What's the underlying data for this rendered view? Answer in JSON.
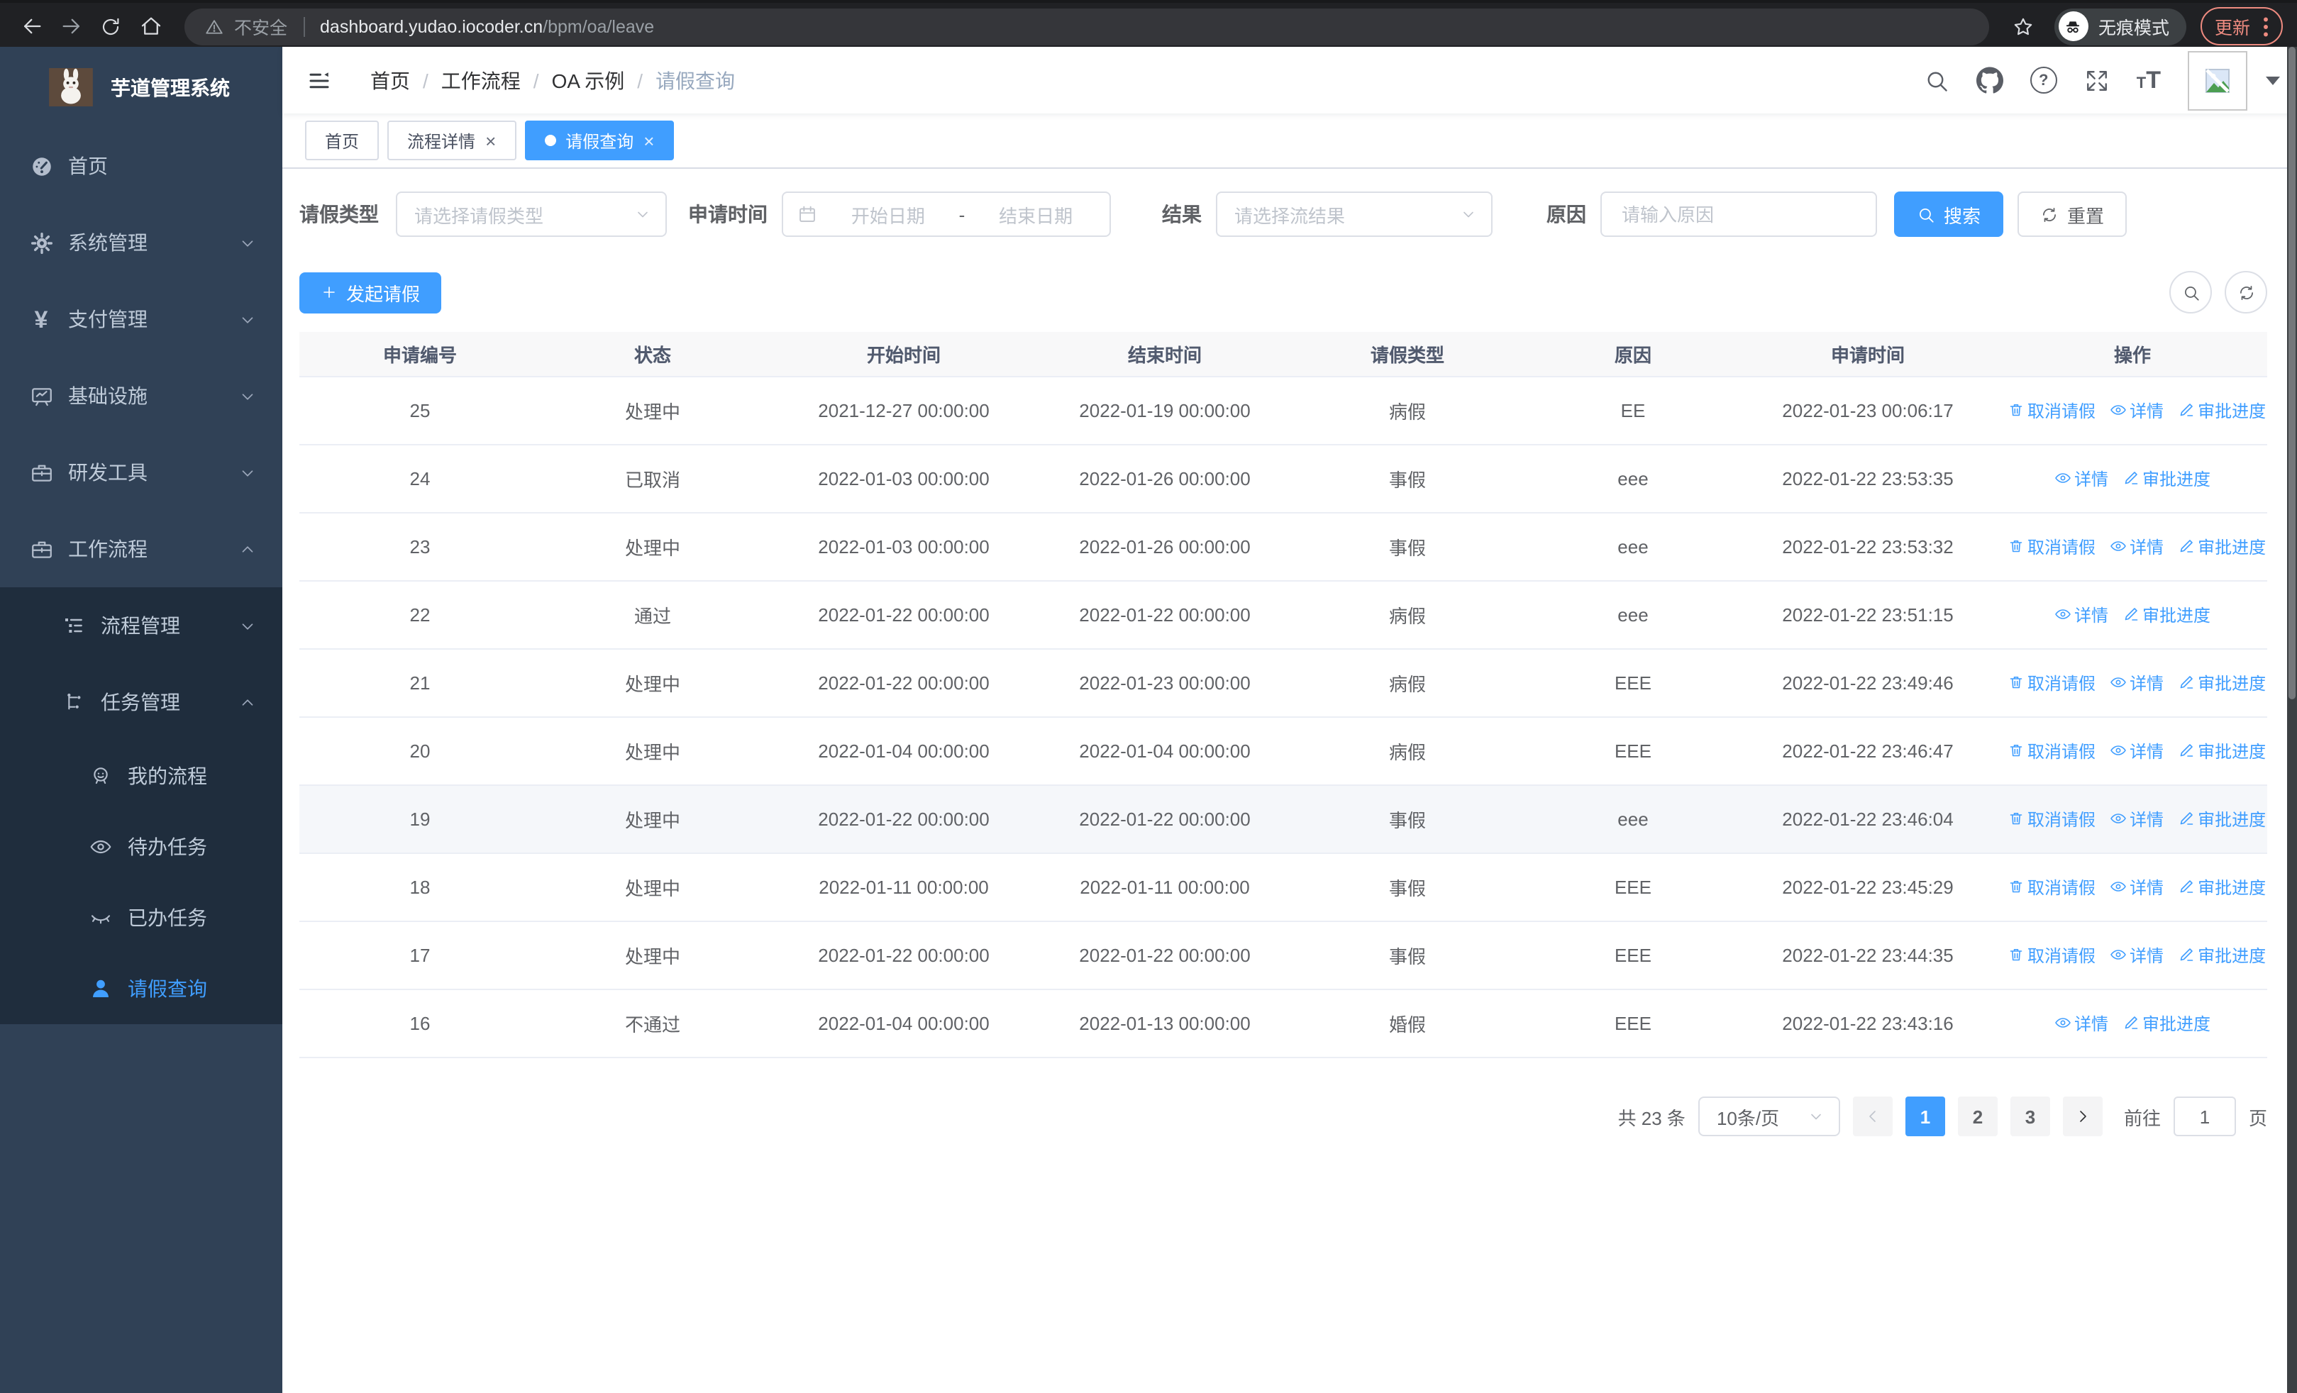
{
  "colors": {
    "primary": "#409eff",
    "sidebar_bg": "#304156",
    "submenu_bg": "#1f2d3d",
    "update_accent": "#ee8b80"
  },
  "browser": {
    "security_label": "不安全",
    "url_host": "dashboard.yudao.iocoder.cn",
    "url_path": "/bpm/oa/leave",
    "incognito_label": "无痕模式",
    "update_label": "更新"
  },
  "sidebar": {
    "title": "芋道管理系统",
    "items": [
      {
        "label": "首页"
      },
      {
        "label": "系统管理"
      },
      {
        "label": "支付管理"
      },
      {
        "label": "基础设施"
      },
      {
        "label": "研发工具"
      },
      {
        "label": "工作流程"
      },
      {
        "label": "流程管理"
      },
      {
        "label": "任务管理"
      },
      {
        "label": "我的流程"
      },
      {
        "label": "待办任务"
      },
      {
        "label": "已办任务"
      },
      {
        "label": "请假查询"
      }
    ]
  },
  "header": {
    "breadcrumb": [
      "首页",
      "工作流程",
      "OA 示例",
      "请假查询"
    ],
    "breadcrumb_separator": "/"
  },
  "tabs": [
    {
      "label": "首页",
      "closable": false,
      "active": false
    },
    {
      "label": "流程详情",
      "closable": true,
      "active": false
    },
    {
      "label": "请假查询",
      "closable": true,
      "active": true
    }
  ],
  "ui": {
    "close_glyph": "×",
    "question_glyph": "?",
    "pay_symbol": "¥",
    "font_small": "T",
    "font_large": "T"
  },
  "filters": {
    "leave_type": {
      "label": "请假类型",
      "placeholder": "请选择请假类型"
    },
    "apply_time": {
      "label": "申请时间",
      "start_placeholder": "开始日期",
      "separator": "-",
      "end_placeholder": "结束日期"
    },
    "result": {
      "label": "结果",
      "placeholder": "请选择流结果"
    },
    "reason": {
      "label": "原因",
      "placeholder": "请输入原因"
    },
    "search_label": "搜索",
    "reset_label": "重置"
  },
  "toolbar": {
    "create_label": "发起请假"
  },
  "table": {
    "columns": [
      "申请编号",
      "状态",
      "开始时间",
      "结束时间",
      "请假类型",
      "原因",
      "申请时间",
      "操作"
    ],
    "action_labels": {
      "cancel": "取消请假",
      "detail": "详情",
      "progress": "审批进度"
    },
    "rows": [
      {
        "id": "25",
        "status": "处理中",
        "start": "2021-12-27 00:00:00",
        "end": "2022-01-19 00:00:00",
        "type": "病假",
        "reason": "EE",
        "applied": "2022-01-23 00:06:17",
        "cancel": true,
        "highlight": false
      },
      {
        "id": "24",
        "status": "已取消",
        "start": "2022-01-03 00:00:00",
        "end": "2022-01-26 00:00:00",
        "type": "事假",
        "reason": "eee",
        "applied": "2022-01-22 23:53:35",
        "cancel": false,
        "highlight": false
      },
      {
        "id": "23",
        "status": "处理中",
        "start": "2022-01-03 00:00:00",
        "end": "2022-01-26 00:00:00",
        "type": "事假",
        "reason": "eee",
        "applied": "2022-01-22 23:53:32",
        "cancel": true,
        "highlight": false
      },
      {
        "id": "22",
        "status": "通过",
        "start": "2022-01-22 00:00:00",
        "end": "2022-01-22 00:00:00",
        "type": "病假",
        "reason": "eee",
        "applied": "2022-01-22 23:51:15",
        "cancel": false,
        "highlight": false
      },
      {
        "id": "21",
        "status": "处理中",
        "start": "2022-01-22 00:00:00",
        "end": "2022-01-23 00:00:00",
        "type": "病假",
        "reason": "EEE",
        "applied": "2022-01-22 23:49:46",
        "cancel": true,
        "highlight": false
      },
      {
        "id": "20",
        "status": "处理中",
        "start": "2022-01-04 00:00:00",
        "end": "2022-01-04 00:00:00",
        "type": "病假",
        "reason": "EEE",
        "applied": "2022-01-22 23:46:47",
        "cancel": true,
        "highlight": false
      },
      {
        "id": "19",
        "status": "处理中",
        "start": "2022-01-22 00:00:00",
        "end": "2022-01-22 00:00:00",
        "type": "事假",
        "reason": "eee",
        "applied": "2022-01-22 23:46:04",
        "cancel": true,
        "highlight": true
      },
      {
        "id": "18",
        "status": "处理中",
        "start": "2022-01-11 00:00:00",
        "end": "2022-01-11 00:00:00",
        "type": "事假",
        "reason": "EEE",
        "applied": "2022-01-22 23:45:29",
        "cancel": true,
        "highlight": false
      },
      {
        "id": "17",
        "status": "处理中",
        "start": "2022-01-22 00:00:00",
        "end": "2022-01-22 00:00:00",
        "type": "事假",
        "reason": "EEE",
        "applied": "2022-01-22 23:44:35",
        "cancel": true,
        "highlight": false
      },
      {
        "id": "16",
        "status": "不通过",
        "start": "2022-01-04 00:00:00",
        "end": "2022-01-13 00:00:00",
        "type": "婚假",
        "reason": "EEE",
        "applied": "2022-01-22 23:43:16",
        "cancel": false,
        "highlight": false
      }
    ]
  },
  "pagination": {
    "total_text": "共 23 条",
    "page_size": "10条/页",
    "pages": [
      "1",
      "2",
      "3"
    ],
    "active_page": "1",
    "jump_prefix": "前往",
    "jump_value": "1",
    "jump_suffix": "页"
  }
}
